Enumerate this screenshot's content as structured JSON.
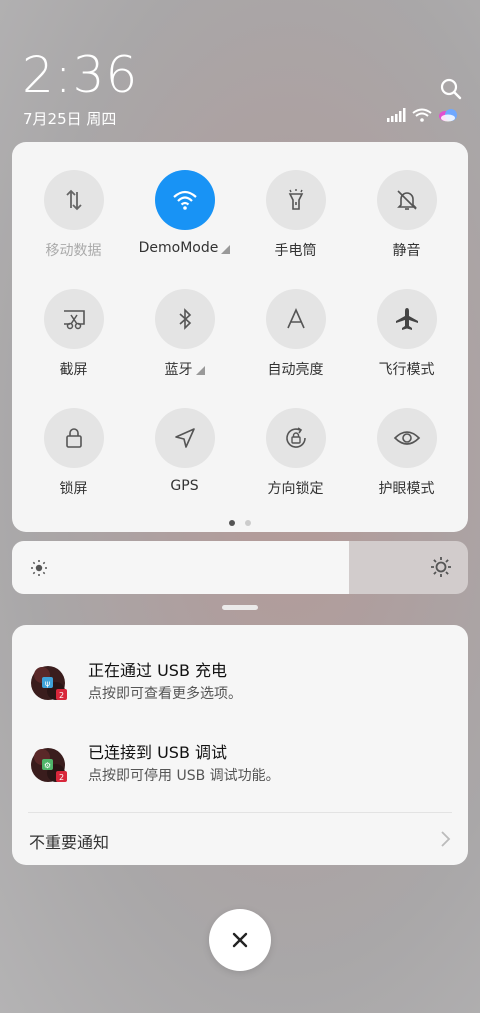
{
  "clock": {
    "time": "2:36",
    "date": "7月25日 周四"
  },
  "toggles": [
    {
      "label": "移动数据",
      "icon": "mobile-data-icon",
      "active": false,
      "dim": true,
      "expand": false
    },
    {
      "label": "DemoMode",
      "icon": "wifi-icon",
      "active": true,
      "dim": false,
      "expand": true
    },
    {
      "label": "手电筒",
      "icon": "flashlight-icon",
      "active": false,
      "dim": false,
      "expand": false
    },
    {
      "label": "静音",
      "icon": "bell-off-icon",
      "active": false,
      "dim": false,
      "expand": false
    },
    {
      "label": "截屏",
      "icon": "screenshot-icon",
      "active": false,
      "dim": false,
      "expand": false
    },
    {
      "label": "蓝牙",
      "icon": "bluetooth-icon",
      "active": false,
      "dim": false,
      "expand": true
    },
    {
      "label": "自动亮度",
      "icon": "auto-brightness-icon",
      "active": false,
      "dim": false,
      "expand": false
    },
    {
      "label": "飞行模式",
      "icon": "airplane-icon",
      "active": false,
      "dim": false,
      "expand": false
    },
    {
      "label": "锁屏",
      "icon": "lock-icon",
      "active": false,
      "dim": false,
      "expand": false
    },
    {
      "label": "GPS",
      "icon": "gps-icon",
      "active": false,
      "dim": false,
      "expand": false
    },
    {
      "label": "方向锁定",
      "icon": "rotation-lock-icon",
      "active": false,
      "dim": false,
      "expand": false
    },
    {
      "label": "护眼模式",
      "icon": "eye-icon",
      "active": false,
      "dim": false,
      "expand": false
    }
  ],
  "pager": {
    "count": 2,
    "active": 0
  },
  "brightness": {
    "level": 0.74
  },
  "notifications": [
    {
      "title": "正在通过 USB 充电",
      "subtitle": "点按即可查看更多选项。"
    },
    {
      "title": "已连接到 USB 调试",
      "subtitle": "点按即可停用 USB 调试功能。"
    }
  ],
  "unimportant_label": "不重要通知",
  "colors": {
    "accent": "#1893f5"
  }
}
